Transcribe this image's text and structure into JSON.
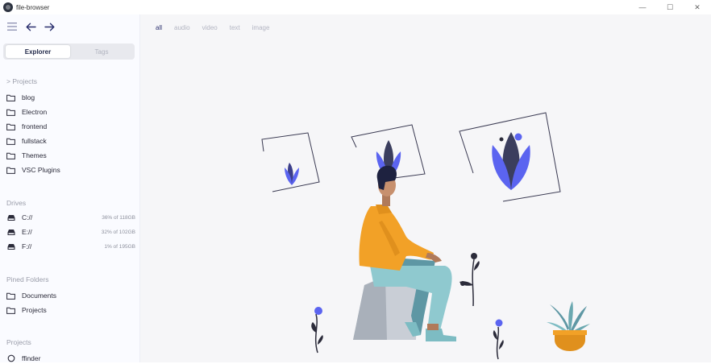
{
  "window": {
    "title": "file-browser",
    "controls": [
      "—",
      "☐",
      "✕"
    ]
  },
  "sidebar": {
    "tabs": {
      "explorer": "Explorer",
      "tags": "Tags"
    },
    "projects_header": "> Projects",
    "project_folders": [
      "blog",
      "Electron",
      "frontend",
      "fullstack",
      "Themes",
      "VSC Plugins"
    ],
    "drives_header": "Drives",
    "drives": [
      {
        "name": "C://",
        "usage": "36% of 118GB"
      },
      {
        "name": "E://",
        "usage": "32% of 102GB"
      },
      {
        "name": "F://",
        "usage": "1% of 195GB"
      }
    ],
    "pinned_header": "Pined Folders",
    "pinned_folders": [
      "Documents",
      "Projects"
    ],
    "projects2_header": "Projects",
    "projects2": [
      "ffinder"
    ]
  },
  "main": {
    "filters": [
      "all",
      "audio",
      "video",
      "text",
      "image"
    ],
    "active_filter": "all"
  },
  "colors": {
    "accent": "#2a2f6e",
    "sidebar_bg": "#fafbff",
    "main_bg": "#f6f6f8",
    "illustration_blue": "#5b64f0",
    "illustration_orange": "#f2a127",
    "illustration_teal": "#8fc9cf"
  },
  "icons": {
    "menu": "hamburger-menu-icon",
    "back": "arrow-left-icon",
    "forward": "arrow-right-icon",
    "folder": "folder-icon",
    "drive": "drive-icon",
    "project": "circle-icon"
  }
}
